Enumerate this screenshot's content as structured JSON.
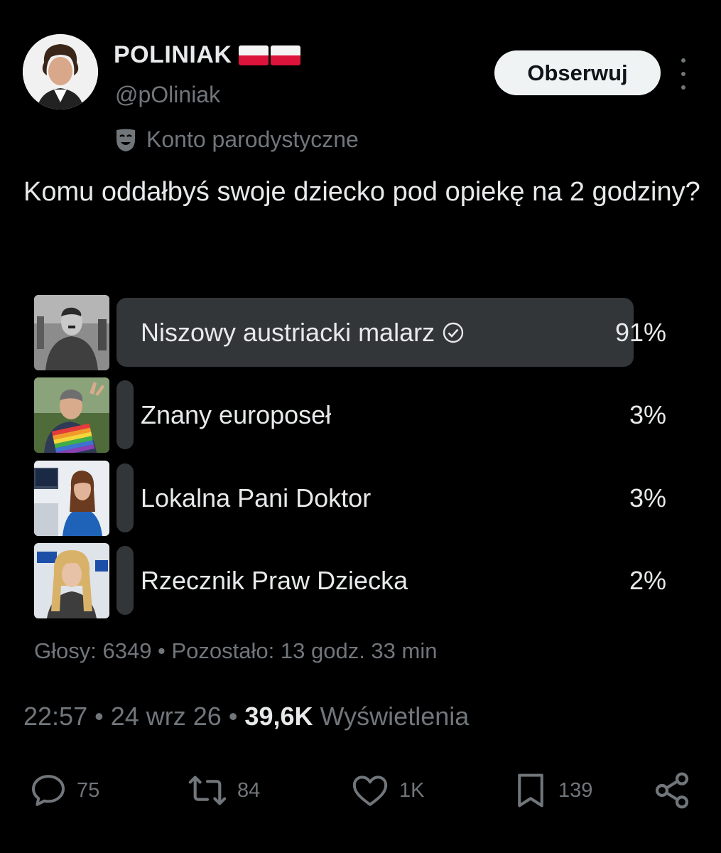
{
  "author": {
    "name": "POLINIAK",
    "handle": "@pOliniak",
    "label": "Konto parodystyczne"
  },
  "follow_label": "Obserwuj",
  "tweet": {
    "text": "Komu oddałbyś swoje dziecko pod opiekę na 2 godziny?"
  },
  "poll": {
    "options": [
      {
        "label": "Niszowy austriacki malarz",
        "percent": "91%",
        "share": 0.91,
        "selected": true
      },
      {
        "label": "Znany europoseł",
        "percent": "3%",
        "share": 0.03,
        "selected": false
      },
      {
        "label": "Lokalna Pani Doktor",
        "percent": "3%",
        "share": 0.03,
        "selected": false
      },
      {
        "label": "Rzecznik Praw Dziecka",
        "percent": "2%",
        "share": 0.02,
        "selected": false
      }
    ],
    "footer": "Głosy: 6349 • Pozostało: 13 godz. 33 min"
  },
  "meta": {
    "time": "22:57",
    "date": "24 wrz 26",
    "views_count": "39,6K",
    "views_label": "Wyświetlenia"
  },
  "actions": {
    "replies": "75",
    "reposts": "84",
    "likes": "1K",
    "bookmarks": "139"
  },
  "colors": {
    "background": "#000000",
    "text": "#e7e9ea",
    "muted": "#71767b",
    "poll_bar": "#333639"
  }
}
